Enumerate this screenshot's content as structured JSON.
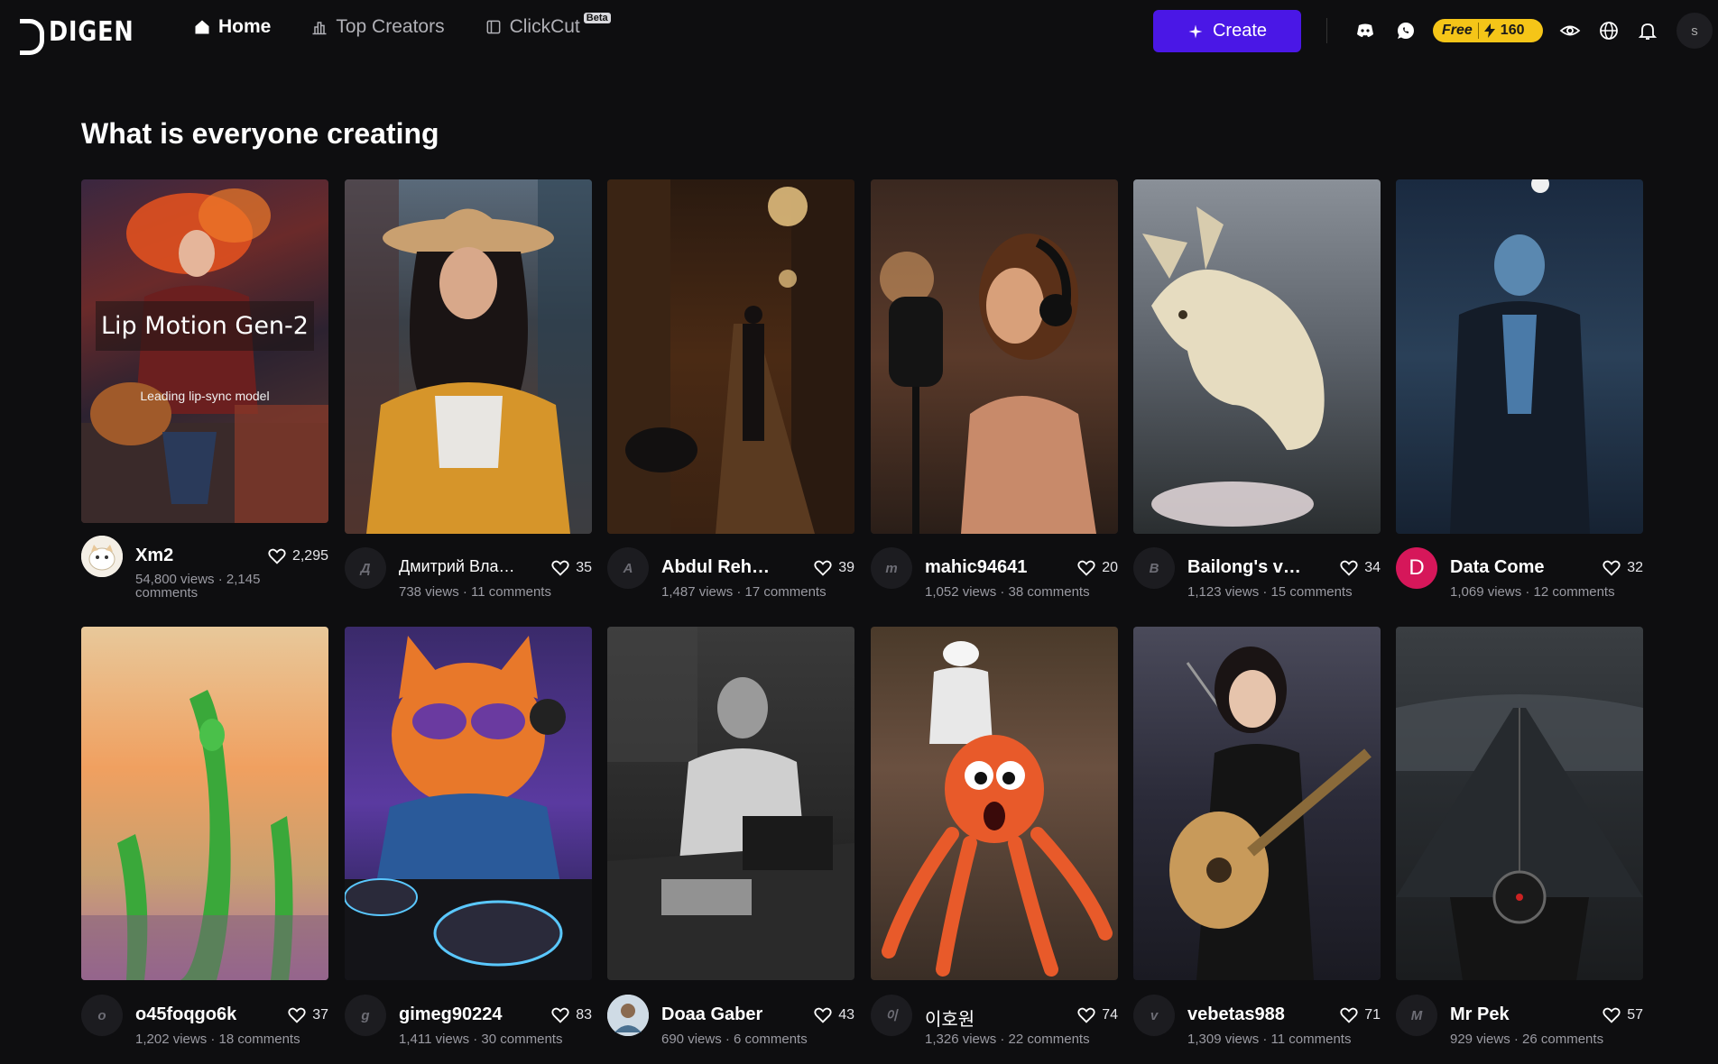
{
  "app": {
    "logo_text": "DIGEN"
  },
  "nav": {
    "items": [
      {
        "label": "Home",
        "icon": "home-icon",
        "active": true
      },
      {
        "label": "Top Creators",
        "icon": "bar-chart-icon",
        "active": false
      },
      {
        "label": "ClickCut",
        "icon": "clip-icon",
        "active": false,
        "badge": "Beta"
      }
    ]
  },
  "header": {
    "create_label": "Create",
    "credits_plan": "Free",
    "credits_amount": "160",
    "user_initial": "s"
  },
  "section_title": "What is everyone creating",
  "featured_overlay": {
    "title": "Lip Motion Gen-2",
    "subtitle": "Leading lip-sync model"
  },
  "cards": [
    {
      "user": "Xm2",
      "avatar": "",
      "likes": "2,295",
      "stats": "54,800 views · 2,145 comments"
    },
    {
      "user": "Дмитрий Влад...",
      "avatar": "Д",
      "likes": "35",
      "stats": "738 views · 11 comments"
    },
    {
      "user": "Abdul Rehman",
      "avatar": "A",
      "likes": "39",
      "stats": "1,487 views · 17 comments"
    },
    {
      "user": "mahic94641",
      "avatar": "m",
      "likes": "20",
      "stats": "1,052 views · 38 comments"
    },
    {
      "user": "Bailong's vlogs",
      "avatar": "B",
      "likes": "34",
      "stats": "1,123 views · 15 comments"
    },
    {
      "user": "Data Come",
      "avatar": "D",
      "likes": "32",
      "stats": "1,069 views · 12 comments"
    },
    {
      "user": "o45foqgo6k",
      "avatar": "o",
      "likes": "37",
      "stats": "1,202 views · 18 comments"
    },
    {
      "user": "gimeg90224",
      "avatar": "g",
      "likes": "83",
      "stats": "1,411 views · 30 comments"
    },
    {
      "user": "Doaa Gaber",
      "avatar": "",
      "likes": "43",
      "stats": "690 views · 6 comments"
    },
    {
      "user": "이호원",
      "avatar": "이",
      "likes": "74",
      "stats": "1,326 views · 22 comments"
    },
    {
      "user": "vebetas988",
      "avatar": "v",
      "likes": "71",
      "stats": "1,309 views · 11 comments"
    },
    {
      "user": "Mr Pek",
      "avatar": "M",
      "likes": "57",
      "stats": "929 views · 26 comments"
    }
  ],
  "colors": {
    "accent": "#4a17e6",
    "credits": "#f5c518",
    "background": "#0e0e10"
  }
}
